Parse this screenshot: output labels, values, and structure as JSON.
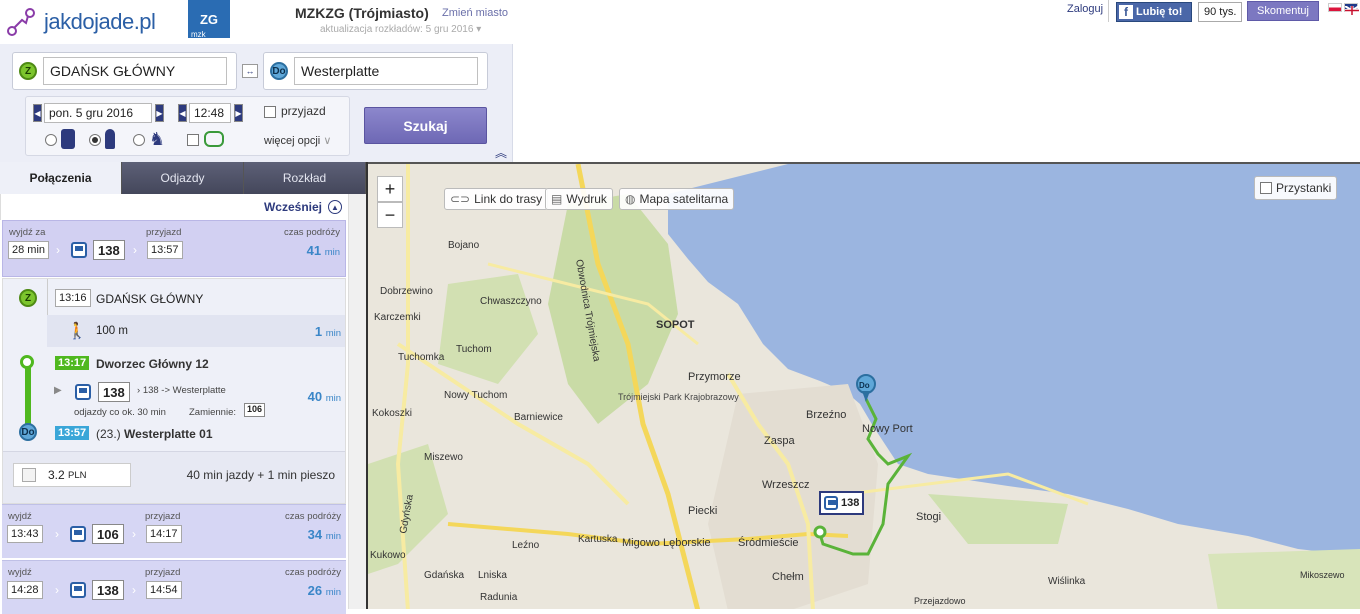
{
  "header": {
    "logo_text": "jakdojade.pl",
    "mzk_badge": "ZG",
    "mzk_sub": "mzk",
    "city": "MZKZG (Trójmiasto)",
    "change_city": "Zmień miasto",
    "update": "aktualizacja rozkładów: 5 gru 2016",
    "login": "Zaloguj",
    "fb_like": "Lubię to!",
    "fb_count": "90 tys.",
    "comment_btn": "Skomentuj"
  },
  "search": {
    "from_badge": "Z",
    "from_value": "GDAŃSK GŁÓWNY",
    "to_badge": "Do",
    "to_value": "Westerplatte",
    "date": "pon. 5 gru 2016",
    "time": "12:48",
    "arrival_label": "przyjazd",
    "more_options": "więcej opcji",
    "search_btn": "Szukaj"
  },
  "tabs": [
    "Połączenia",
    "Odjazdy",
    "Rozkład"
  ],
  "earlier": "Wcześniej",
  "connections": [
    {
      "leave_label": "wyjdź za",
      "leave": "28 min",
      "line": "138",
      "arrive_label": "przyjazd",
      "arrive": "13:57",
      "dur_label": "czas podróży",
      "dur": "41",
      "dur_unit": "min"
    },
    {
      "leave_label": "wyjdź",
      "leave": "13:43",
      "line": "106",
      "arrive_label": "przyjazd",
      "arrive": "14:17",
      "dur_label": "czas podróży",
      "dur": "34",
      "dur_unit": "min"
    },
    {
      "leave_label": "wyjdź",
      "leave": "14:28",
      "line": "138",
      "arrive_label": "przyjazd",
      "arrive": "14:54",
      "dur_label": "czas podróży",
      "dur": "26",
      "dur_unit": "min"
    }
  ],
  "detail": {
    "start_time": "13:16",
    "start_name": "GDAŃSK GŁÓWNY",
    "walk_dist": "100 m",
    "walk_dur": "1",
    "walk_unit": "min",
    "board_time": "13:17",
    "board_stop": "Dworzec Główny 12",
    "line": "138",
    "direction": "138 -> Westerplatte",
    "freq": "odjazdy co ok. 30 min",
    "alt_label": "Zamiennie:",
    "alt_line": "106",
    "ride_dur": "40",
    "ride_unit": "min",
    "end_time": "13:57",
    "end_prefix": "(23.)",
    "end_stop": "Westerplatte 01",
    "price": "3.2",
    "currency": "PLN",
    "summary": "40 min jazdy + 1 min pieszo"
  },
  "map": {
    "link": "Link do trasy",
    "print": "Wydruk",
    "satellite": "Mapa satelitarna",
    "stops": "Przystanki",
    "zoom_in": "+",
    "zoom_out": "−",
    "bus_label": "138",
    "labels": [
      "Bojano",
      "Chwaszczyno",
      "SOPOT",
      "Dobrzewino",
      "Karczemki",
      "Tuchomka",
      "Tuchom",
      "Kokoszki",
      "Nowy Tuchom",
      "Barniewice",
      "Przymorze",
      "Trójmiejski Park Krajobrazowy",
      "Brzeźno",
      "Nowy Port",
      "Zaspa",
      "Wrzeszcz",
      "Stogi",
      "Piecki",
      "Miszewo",
      "Gdyńska",
      "Kartuska",
      "Migowo Lęborskie",
      "Śródmieście",
      "Leźno",
      "Chełm",
      "Gdańska",
      "Lniska",
      "Radunia",
      "Kukowo",
      "Obwodnica Trójmiejska",
      "Wiślinka",
      "Mikoszewo",
      "Przejazdowo",
      "Do"
    ]
  },
  "colors": {
    "accent": "#6e68b5",
    "route": "#5ab339",
    "water": "#99b3df",
    "forest": "#c9dba6",
    "road": "#f6e99a"
  }
}
